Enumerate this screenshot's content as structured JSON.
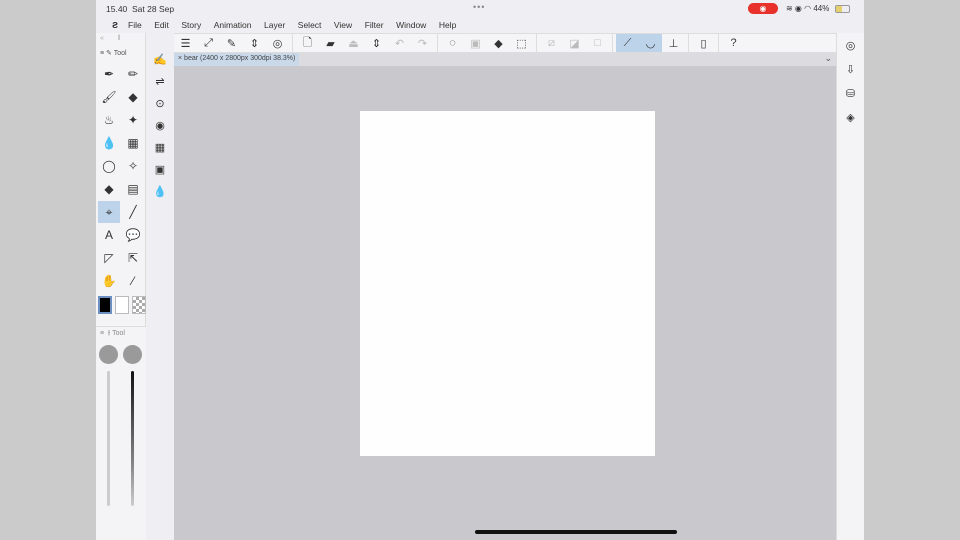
{
  "status": {
    "time": "15.40",
    "date": "Sat 28 Sep",
    "battery": "44%",
    "battery_level": 0.44
  },
  "menu": [
    "File",
    "Edit",
    "Story",
    "Animation",
    "Layer",
    "Select",
    "View",
    "Filter",
    "Window",
    "Help"
  ],
  "tab": {
    "label": "bear (2400 x 2800px 300dpi 38.3%)"
  },
  "panels": {
    "tool_label": "Tool",
    "subtool_label": "Tool"
  },
  "toolbar": [
    {
      "name": "menu-icon",
      "g": "☰"
    },
    {
      "name": "fit-icon",
      "g": "⤢"
    },
    {
      "name": "eyedropper-settings-icon",
      "g": "✎"
    },
    {
      "name": "stepper-icon",
      "g": "⇕"
    },
    {
      "name": "record-icon",
      "g": "◎"
    },
    {
      "sep": true
    },
    {
      "name": "new-file-icon",
      "g": "🗋"
    },
    {
      "name": "open-folder-icon",
      "g": "▰"
    },
    {
      "name": "save-icon",
      "g": "⏏",
      "dim": true
    },
    {
      "name": "stepper2-icon",
      "g": "⇕"
    },
    {
      "name": "undo-icon",
      "g": "↶",
      "dim": true
    },
    {
      "name": "redo-icon",
      "g": "↷",
      "dim": true
    },
    {
      "sep": true
    },
    {
      "name": "deselect-icon",
      "g": "◌"
    },
    {
      "name": "selection-icon",
      "g": "▣",
      "dim": true
    },
    {
      "name": "fill-icon",
      "g": "◆"
    },
    {
      "name": "transform-icon",
      "g": "⬚"
    },
    {
      "sep": true
    },
    {
      "name": "clear-icon",
      "g": "⧄",
      "dim": true
    },
    {
      "name": "tone-icon",
      "g": "◪",
      "dim": true
    },
    {
      "name": "border-icon",
      "g": "□",
      "dim": true
    },
    {
      "sep": true
    },
    {
      "name": "ruler-snap-icon",
      "g": "⟋",
      "on": true
    },
    {
      "name": "curve-snap-icon",
      "g": "◡",
      "on": true
    },
    {
      "name": "grid-snap-icon",
      "g": "⊥"
    },
    {
      "sep": true
    },
    {
      "name": "device-icon",
      "g": "▯"
    },
    {
      "sep": true
    },
    {
      "name": "help-icon",
      "g": "?"
    }
  ],
  "tools": [
    {
      "name": "pen-tool-icon",
      "g": "✒"
    },
    {
      "name": "pencil-tool-icon",
      "g": "✏"
    },
    {
      "name": "brush-tool-icon",
      "g": "🖌"
    },
    {
      "name": "eraser-tool-icon",
      "g": "◆"
    },
    {
      "name": "airbrush-tool-icon",
      "g": "♨"
    },
    {
      "name": "decoration-tool-icon",
      "g": "✦"
    },
    {
      "name": "blend-tool-icon",
      "g": "💧"
    },
    {
      "name": "frame-tool-icon",
      "g": "▦"
    },
    {
      "name": "lasso-tool-icon",
      "g": "◯"
    },
    {
      "name": "magic-wand-tool-icon",
      "g": "✧"
    },
    {
      "name": "fill-tool-icon",
      "g": "◆"
    },
    {
      "name": "gradient-tool-icon",
      "g": "▤"
    },
    {
      "name": "operation-tool-icon",
      "g": "⌖",
      "on": true
    },
    {
      "name": "line-tool-icon",
      "g": "╱"
    },
    {
      "name": "text-tool-icon",
      "g": "A"
    },
    {
      "name": "balloon-tool-icon",
      "g": "💬"
    },
    {
      "name": "ruler-tool-icon",
      "g": "◸"
    },
    {
      "name": "move-tool-icon",
      "g": "⇱"
    },
    {
      "name": "hand-tool-icon",
      "g": "✋"
    },
    {
      "name": "eyedropper-tool-icon",
      "g": "⁄"
    }
  ],
  "col2": [
    {
      "name": "layer-property-icon",
      "g": "✍"
    },
    {
      "name": "adjust-icon",
      "g": "⇌"
    },
    {
      "name": "animation-icon",
      "g": "⊙"
    },
    {
      "name": "navigator-icon",
      "g": "◉"
    },
    {
      "name": "material-icon",
      "g": "▦"
    },
    {
      "name": "frame-icon",
      "g": "▣"
    },
    {
      "name": "color-mix-icon",
      "g": "💧"
    }
  ],
  "right": [
    {
      "name": "navigator-panel-icon",
      "g": "◎"
    },
    {
      "name": "import-icon",
      "g": "⇩"
    },
    {
      "name": "layers-icon",
      "g": "⛁"
    },
    {
      "name": "layer-stack-icon",
      "g": "◈"
    }
  ],
  "colors": {
    "main": "#000000",
    "sub": "#ffffff",
    "record": "#e8312a",
    "accent": "#bcd3ea"
  }
}
